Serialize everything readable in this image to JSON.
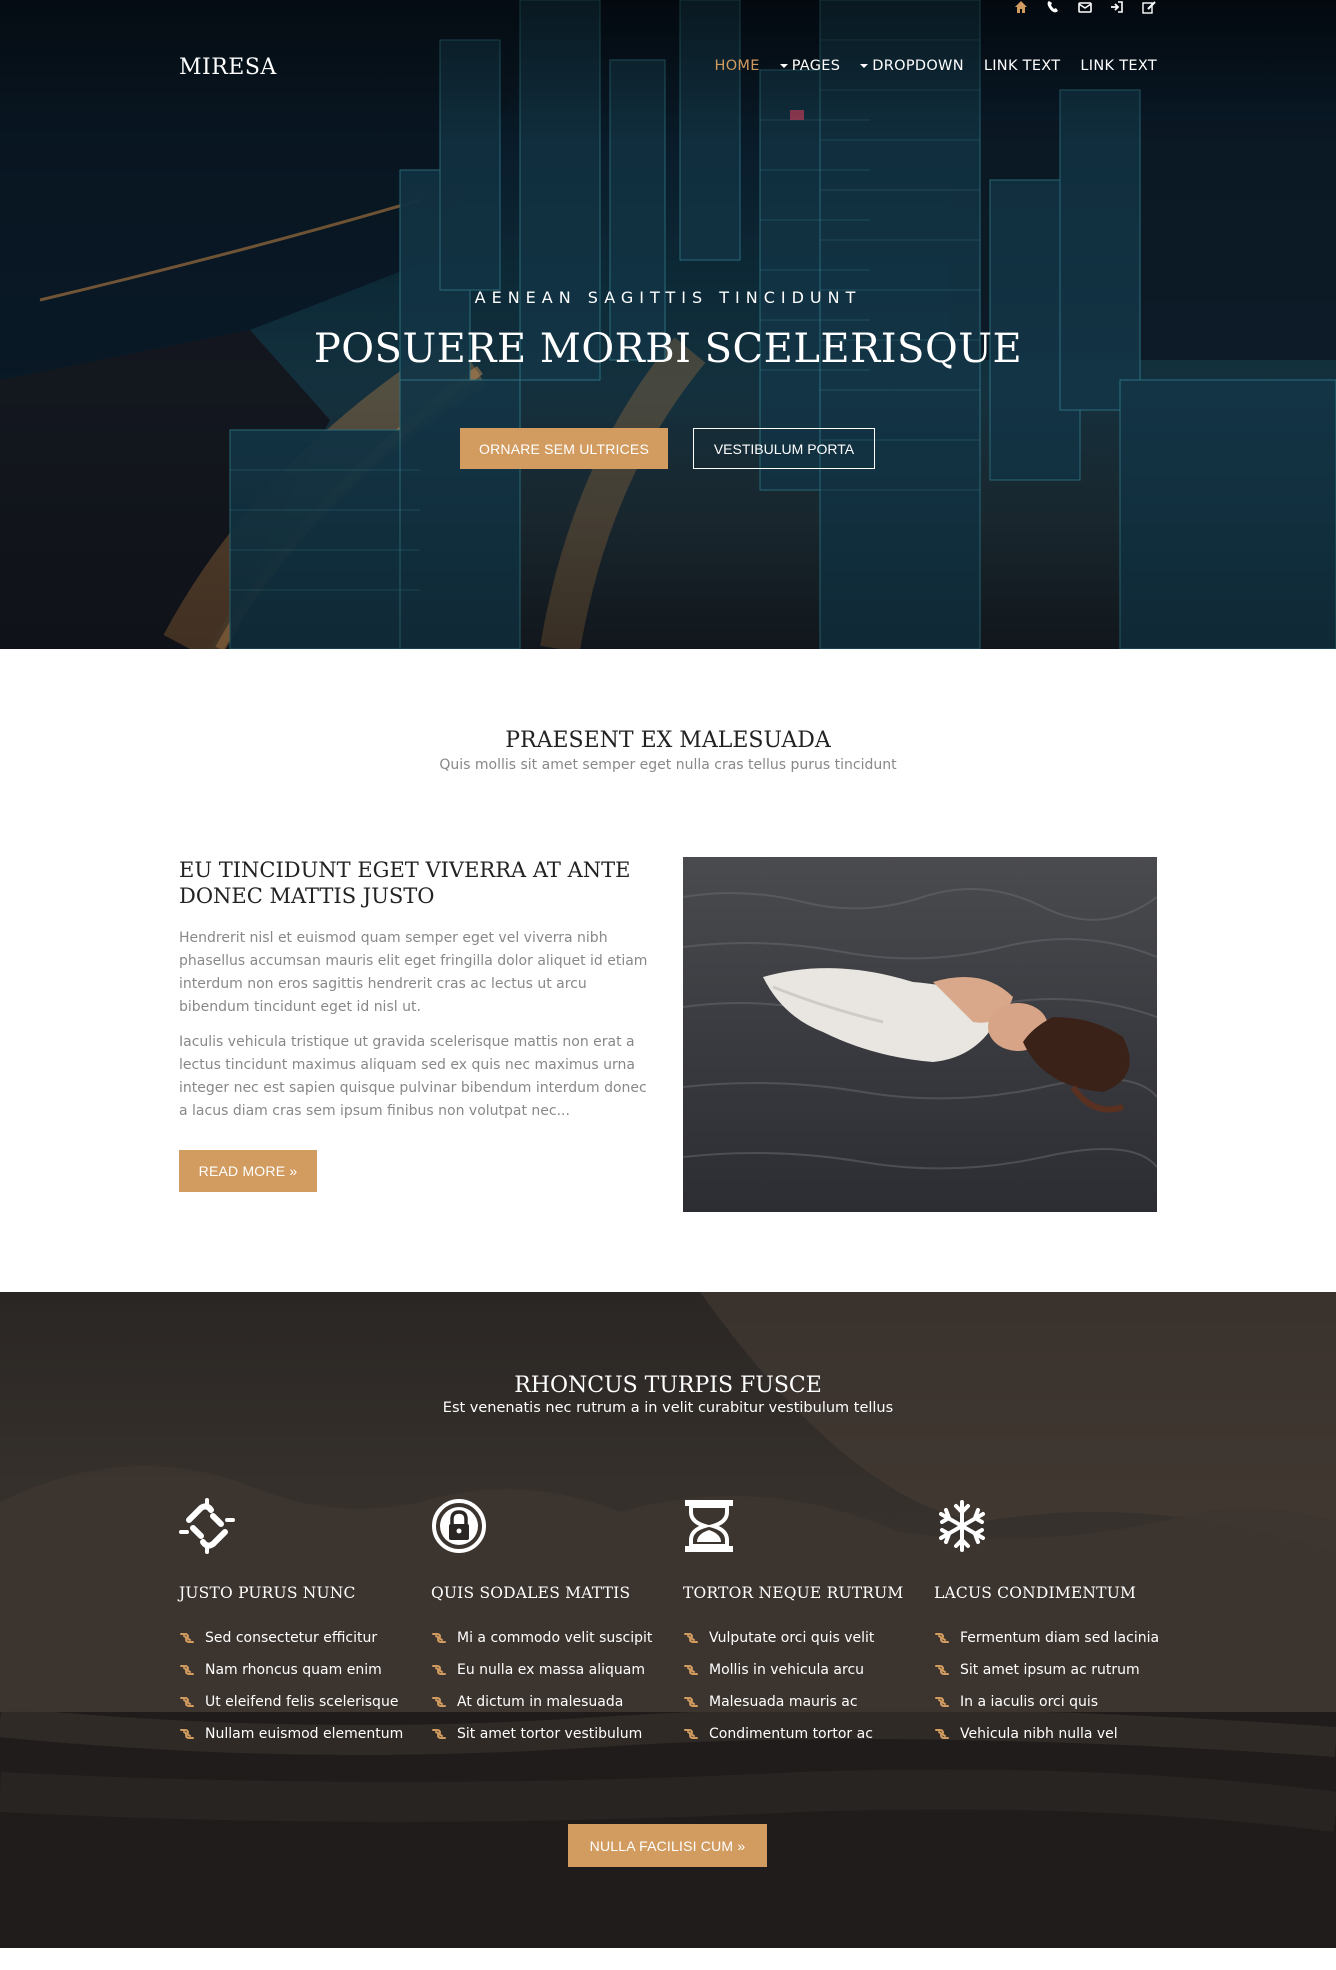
{
  "header": {
    "top_icons": [
      "home-icon",
      "phone-icon",
      "envelope-icon",
      "sign-in-icon",
      "edit-icon"
    ],
    "brand": "MIRESA",
    "nav": [
      {
        "label": "HOME",
        "active": true,
        "dropdown": false
      },
      {
        "label": "PAGES",
        "active": false,
        "dropdown": true
      },
      {
        "label": "DROPDOWN",
        "active": false,
        "dropdown": true
      },
      {
        "label": "LINK TEXT",
        "active": false,
        "dropdown": false
      },
      {
        "label": "LINK TEXT",
        "active": false,
        "dropdown": false
      }
    ]
  },
  "hero": {
    "kicker": "AENEAN SAGITTIS TINCIDUNT",
    "title": "POSUERE MORBI SCELERISQUE",
    "primary_button": "ORNARE SEM ULTRICES",
    "secondary_button": "VESTIBULUM PORTA"
  },
  "intro": {
    "title": "PRAESENT EX MALESUADA",
    "subtitle": "Quis mollis sit amet semper eget nulla cras tellus purus tincidunt",
    "article_title": "EU TINCIDUNT EGET VIVERRA AT ANTE DONEC MATTIS JUSTO",
    "paragraph1": "Hendrerit nisl et euismod quam semper eget vel viverra nibh phasellus accumsan mauris elit eget fringilla dolor aliquet id etiam interdum non eros sagittis hendrerit cras ac lectus ut arcu bibendum tincidunt eget id nisl ut.",
    "paragraph2": "Iaculis vehicula tristique ut gravida scelerisque mattis non erat a lectus tincidunt maximus aliquam sed ex quis nec maximus urna integer nec est sapien quisque pulvinar bibendum interdum donec a lacus diam cras sem ipsum finibus non volutpat nec...",
    "read_more": "READ MORE »"
  },
  "features": {
    "title": "RHONCUS TURPIS FUSCE",
    "subtitle": "Est venenatis nec rutrum a in velit curabitur vestibulum tellus",
    "columns": [
      {
        "icon": "unlink-icon",
        "heading": "JUSTO PURUS NUNC",
        "items": [
          "Sed consectetur efficitur",
          "Nam rhoncus quam enim",
          "Ut eleifend felis scelerisque",
          "Nullam euismod elementum"
        ]
      },
      {
        "icon": "lock-icon",
        "heading": "QUIS SODALES MATTIS",
        "items": [
          "Mi a commodo velit suscipit",
          "Eu nulla ex massa aliquam",
          "At dictum in malesuada",
          "Sit amet tortor vestibulum"
        ]
      },
      {
        "icon": "hourglass-icon",
        "heading": "TORTOR NEQUE RUTRUM",
        "items": [
          "Vulputate orci quis velit",
          "Mollis in vehicula arcu",
          "Malesuada mauris ac",
          "Condimentum tortor ac"
        ]
      },
      {
        "icon": "snowflake-icon",
        "heading": "LACUS CONDIMENTUM",
        "items": [
          "Fermentum diam sed lacinia",
          "Sit amet ipsum ac rutrum",
          "In a iaculis orci quis",
          "Vehicula nibh nulla vel"
        ]
      }
    ],
    "button": "NULLA FACILISI CUM »"
  },
  "colors": {
    "accent": "#d29c60",
    "text": "#333333",
    "muted": "#888888"
  }
}
